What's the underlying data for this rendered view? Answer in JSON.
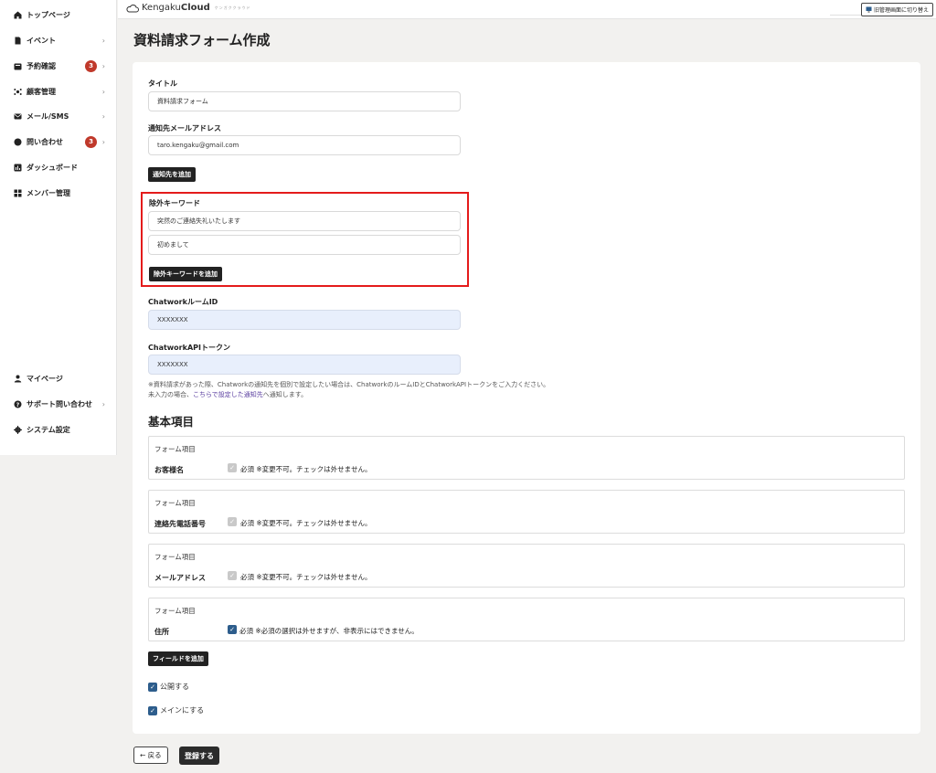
{
  "sidebar": {
    "items": [
      {
        "label": "トップページ",
        "icon": "home-icon"
      },
      {
        "label": "イベント",
        "icon": "document-icon",
        "chevron": "›"
      },
      {
        "label": "予約確認",
        "icon": "inbox-icon",
        "badge": "3",
        "chevron": "›"
      },
      {
        "label": "顧客管理",
        "icon": "users-icon",
        "chevron": "›"
      },
      {
        "label": "メール/SMS",
        "icon": "mail-icon",
        "chevron": "›"
      },
      {
        "label": "問い合わせ",
        "icon": "chat-icon",
        "badge": "3",
        "chevron": "›"
      },
      {
        "label": "ダッシュボード",
        "icon": "chart-icon"
      },
      {
        "label": "メンバー管理",
        "icon": "grid-icon"
      }
    ],
    "bottom_items": [
      {
        "label": "マイページ",
        "icon": "user-icon"
      },
      {
        "label": "サポート問い合わせ",
        "icon": "help-icon",
        "chevron": "›"
      },
      {
        "label": "システム設定",
        "icon": "gear-icon"
      }
    ]
  },
  "header": {
    "logo_light": "Kengaku",
    "logo_bold": "Cloud",
    "logo_sub": "ケンガククラウド",
    "switch_button": "旧管理画面に切り替え"
  },
  "page": {
    "title": "資料請求フォーム作成"
  },
  "form": {
    "title_label": "タイトル",
    "title_value": "資料請求フォーム",
    "email_label": "通知先メールアドレス",
    "email_value": "taro.kengaku@gmail.com",
    "add_recipient": "通知先を追加",
    "exclude_label": "除外キーワード",
    "exclude_values": [
      "突然のご連絡失礼いたします",
      "初めまして"
    ],
    "add_exclude": "除外キーワードを追加",
    "chatwork_room_label": "ChatworkルームID",
    "chatwork_room_value": "XXXXXXX",
    "chatwork_token_label": "ChatworkAPIトークン",
    "chatwork_token_value": "XXXXXXX",
    "note_line1": "※資料請求があった際、Chatworkの通知先を個別で設定したい場合は、ChatworkのルームIDとChatworkAPIトークンをご入力ください。",
    "note_line2_pre": "未入力の場合、",
    "note_line2_link": "こちらで設定した通知先",
    "note_line2_post": "へ通知します。"
  },
  "basic": {
    "title": "基本項目",
    "field_caption": "フォーム項目",
    "fields": [
      {
        "name": "お客様名",
        "checkbox": "disabled",
        "note": "必須 ※変更不可。チェックは外せません。"
      },
      {
        "name": "連絡先電話番号",
        "checkbox": "disabled",
        "note": "必須 ※変更不可。チェックは外せません。"
      },
      {
        "name": "メールアドレス",
        "checkbox": "disabled",
        "note": "必須 ※変更不可。チェックは外せません。"
      },
      {
        "name": "住所",
        "checkbox": "checked",
        "note": "必須 ※必須の選択は外せますが、非表示にはできません。"
      }
    ],
    "add_field": "フィールドを追加"
  },
  "options": {
    "publish": "公開する",
    "main": "メインにする"
  },
  "footer": {
    "back": "← 戻る",
    "save": "登録する"
  },
  "colors": {
    "accent_dark": "#222222",
    "highlight": "#e41b1b",
    "badge": "#c0392b",
    "checkbox": "#2d5d8c",
    "link": "#5b3fa0"
  }
}
